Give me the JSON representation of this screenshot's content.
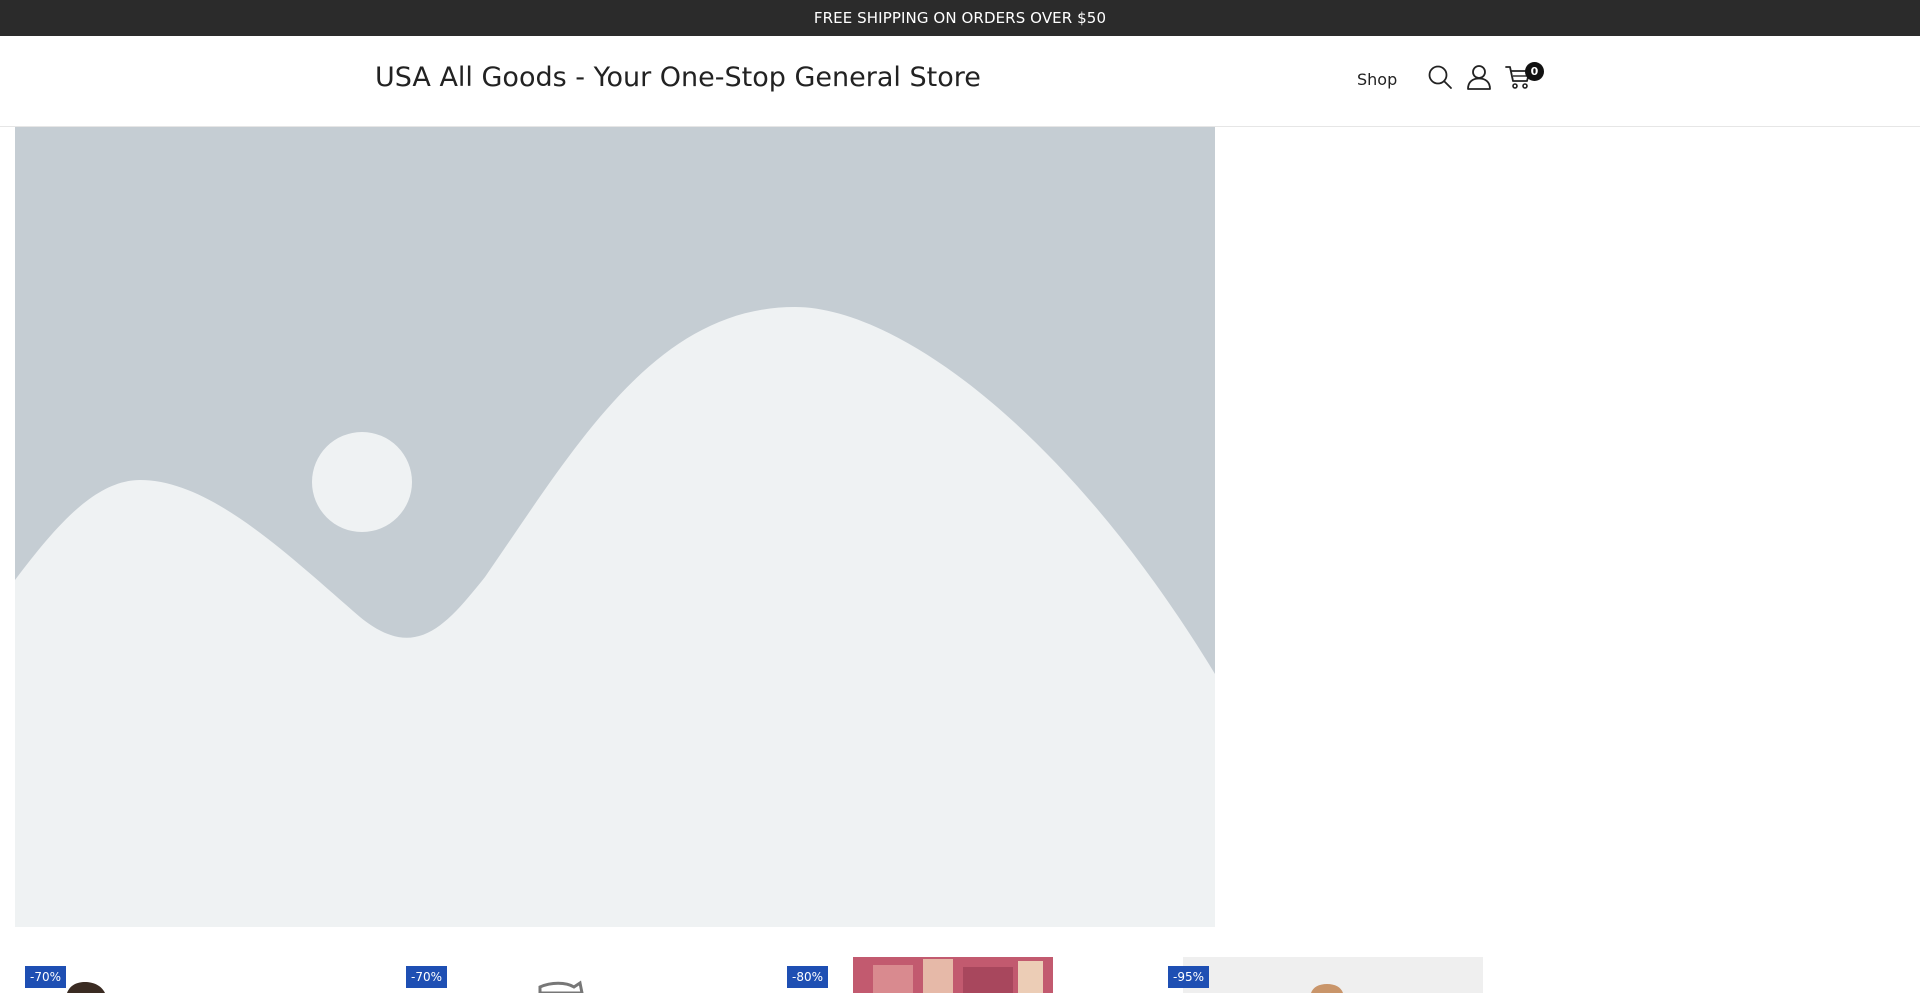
{
  "announcement": {
    "text": "FREE SHIPPING ON ORDERS OVER $50"
  },
  "header": {
    "site_title": "USA All Goods - Your One-Stop General Store",
    "nav": [
      {
        "label": "Shop"
      }
    ],
    "icons": [
      "search-icon",
      "account-icon",
      "cart-icon"
    ],
    "cart_count": "0"
  },
  "hero": {
    "image": "placeholder-landscape-image",
    "colors": {
      "sky": "#c5cdd3",
      "hills": "#eff2f3"
    }
  },
  "products": [
    {
      "badge": "-70%"
    },
    {
      "badge": "-70%"
    },
    {
      "badge": "-80%"
    },
    {
      "badge": "-95%"
    }
  ],
  "colors": {
    "announcement_bg": "#2b2b2b",
    "badge_bg": "#1e4fb3"
  }
}
